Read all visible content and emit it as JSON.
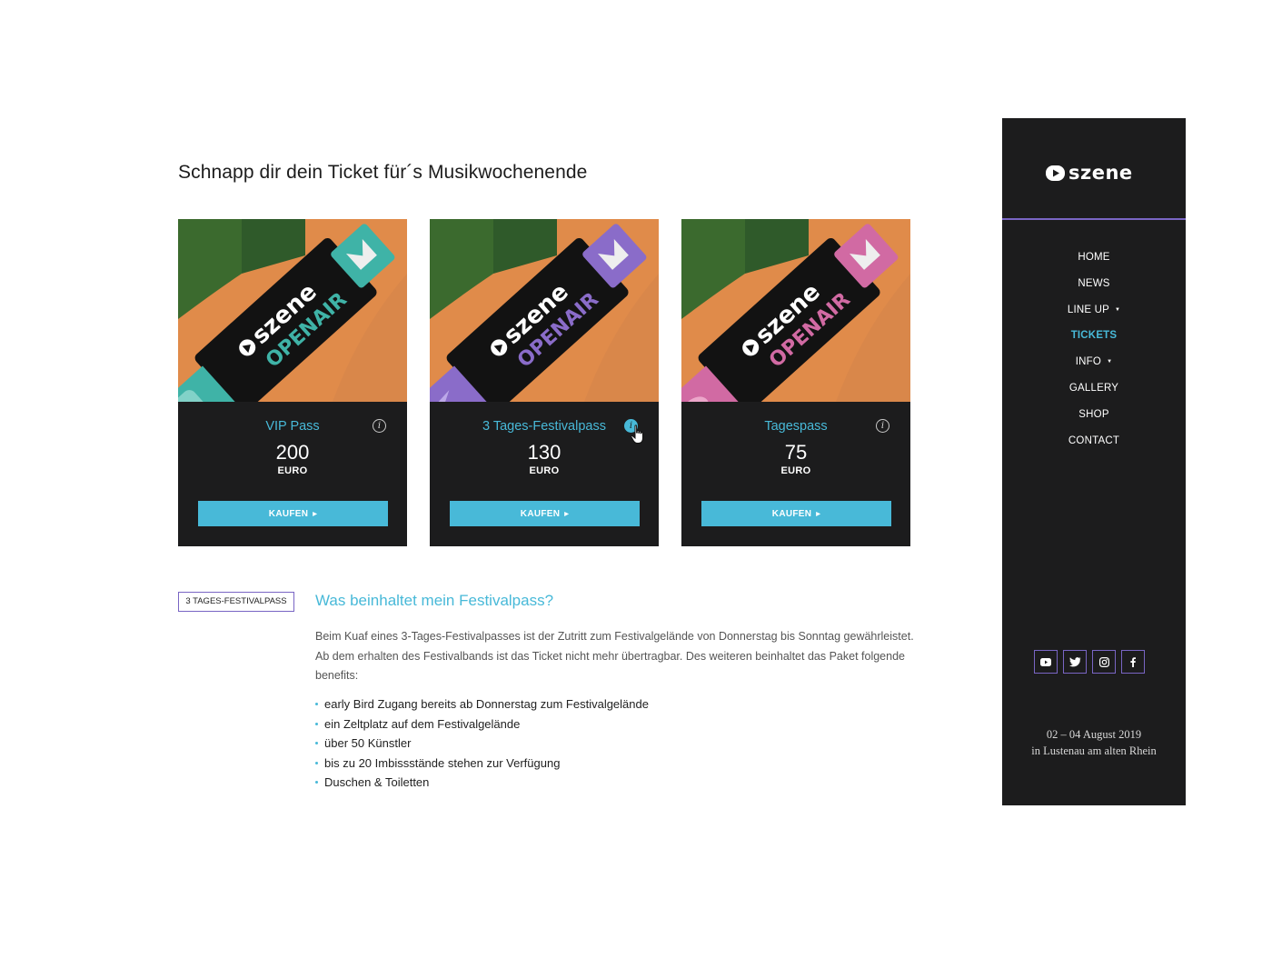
{
  "heading": "Schnapp dir dein Ticket für´s Musikwochenende",
  "cards": [
    {
      "title": "VIP Pass",
      "price": "200",
      "currency": "EURO",
      "button": "KAUFEN",
      "accent": "#3fb3a7",
      "info_active": false
    },
    {
      "title": "3 Tages-Festivalpass",
      "price": "130",
      "currency": "EURO",
      "button": "KAUFEN",
      "accent": "#8a6cc9",
      "info_active": true
    },
    {
      "title": "Tagespass",
      "price": "75",
      "currency": "EURO",
      "button": "KAUFEN",
      "accent": "#d16aa3",
      "info_active": false
    }
  ],
  "wristband": {
    "brand": "szene",
    "event": "OPENAIR"
  },
  "detail": {
    "tag": "3 TAGES-FESTIVALPASS",
    "title": "Was beinhaltet mein Festivalpass?",
    "description": "Beim Kuaf eines 3-Tages-Festivalpasses ist der Zutritt zum Festivalgelände von Donnerstag bis Sonntag gewährleistet. Ab dem erhalten des Festivalbands ist das Ticket nicht mehr übertragbar. Des weiteren beinhaltet das Paket folgende benefits:",
    "benefits": [
      "early Bird Zugang bereits ab Donnerstag zum Festivalgelände",
      "ein Zeltplatz auf dem Festivalgelände",
      "über 50 Künstler",
      "bis zu 20 Imbissstände stehen zur Verfügung",
      "Duschen & Toiletten"
    ]
  },
  "sidebar": {
    "logo": "szene",
    "nav": [
      "HOME",
      "NEWS",
      "LINE UP",
      "TICKETS",
      "INFO",
      "GALLERY",
      "SHOP",
      "CONTACT"
    ],
    "active_item": "TICKETS",
    "socials": [
      "youtube-icon",
      "twitter-icon",
      "instagram-icon",
      "facebook-icon"
    ],
    "date_line1": "02 – 04 August 2019",
    "date_line2": "in Lustenau am alten Rhein"
  },
  "colors": {
    "accent": "#48b9d8",
    "purple": "#7965c4",
    "dark": "#1c1c1d"
  }
}
